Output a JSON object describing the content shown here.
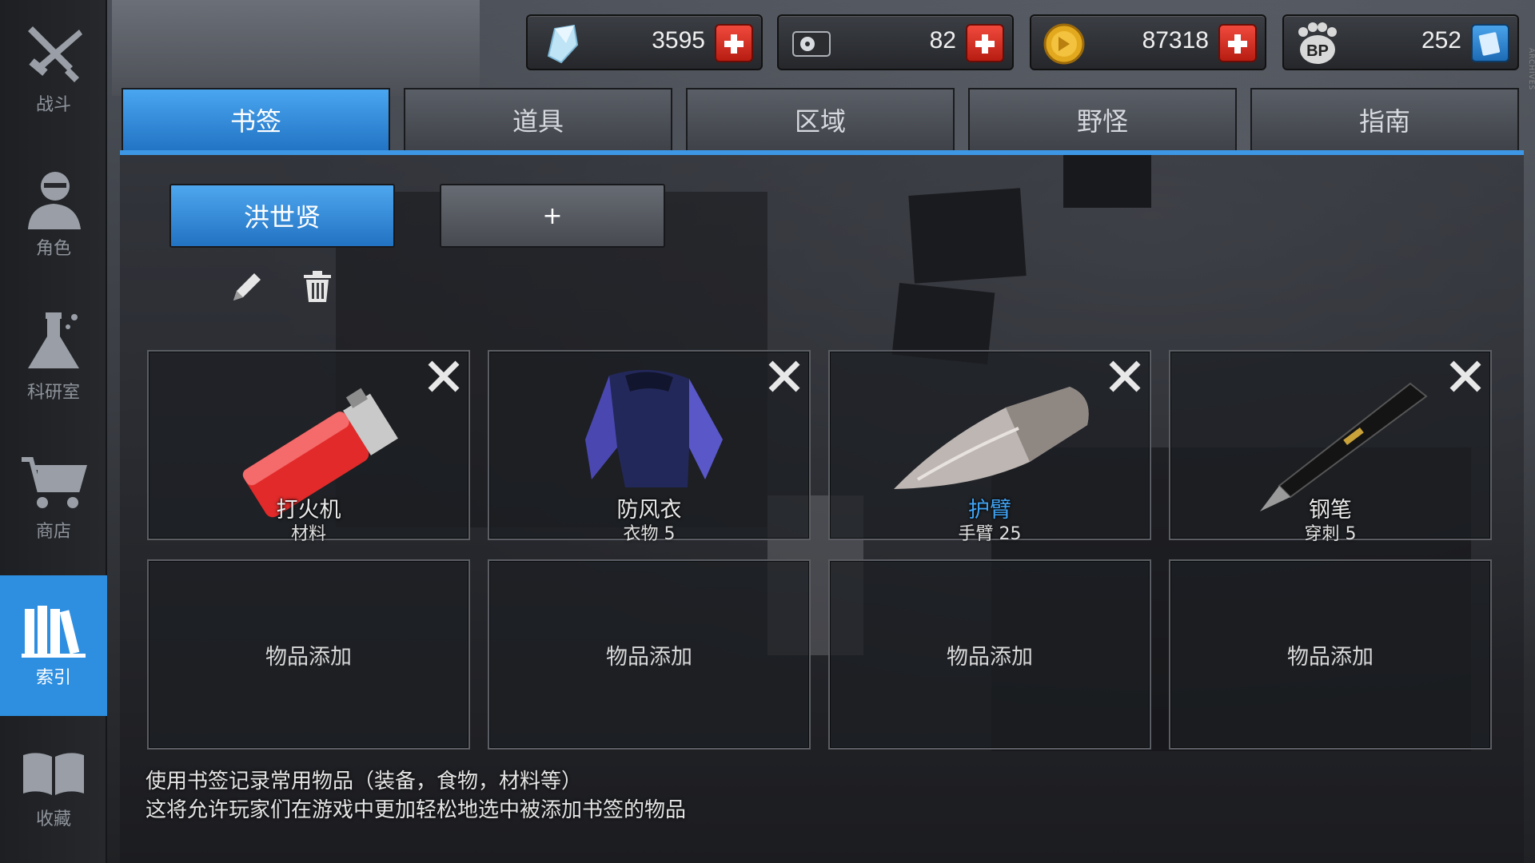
{
  "sidebar": {
    "items": [
      {
        "label": "战斗",
        "icon": "crossed-weapons-icon",
        "active": false
      },
      {
        "label": "角色",
        "icon": "character-portrait-icon",
        "active": false
      },
      {
        "label": "科研室",
        "icon": "flask-icon",
        "active": false
      },
      {
        "label": "商店",
        "icon": "shopping-cart-icon",
        "active": false
      },
      {
        "label": "索引",
        "icon": "books-icon",
        "active": true
      },
      {
        "label": "收藏",
        "icon": "open-book-icon",
        "active": false
      }
    ]
  },
  "currencies": [
    {
      "name": "crystal",
      "icon": "crystal-icon",
      "value": "3595"
    },
    {
      "name": "disk",
      "icon": "disk-icon",
      "value": "82"
    },
    {
      "name": "coin",
      "icon": "gold-coin-icon",
      "value": "87318"
    },
    {
      "name": "bp",
      "icon": "bp-paw-icon",
      "value": "252"
    }
  ],
  "tabs": [
    {
      "label": "书签",
      "active": true
    },
    {
      "label": "道具",
      "active": false
    },
    {
      "label": "区域",
      "active": false
    },
    {
      "label": "野怪",
      "active": false
    },
    {
      "label": "指南",
      "active": false
    }
  ],
  "bookmark": {
    "name": "洪世贤",
    "add_label": "+"
  },
  "slots": [
    {
      "name": "打火机",
      "sub": "材料",
      "art": "lighter",
      "highlight": false
    },
    {
      "name": "防风衣",
      "sub": "衣物 5",
      "art": "windbreaker",
      "highlight": false
    },
    {
      "name": "护臂",
      "sub": "手臂 25",
      "art": "arm-guard",
      "highlight": true
    },
    {
      "name": "钢笔",
      "sub": "穿刺 5",
      "art": "fountain-pen",
      "highlight": false
    }
  ],
  "empty_slots": [
    "物品添加",
    "物品添加",
    "物品添加",
    "物品添加"
  ],
  "footer": {
    "line1": "使用书签记录常用物品（装备，食物，材料等）",
    "line2": "这将允许玩家们在游戏中更加轻松地选中被添加书签的物品"
  },
  "side_deco_text": "ARCHIVES",
  "colors": {
    "accent_blue": "#2e8fe0",
    "tab_active": "#3d97e4",
    "highlight_text": "#3fa3f5",
    "plus_red": "#e03a2c"
  }
}
